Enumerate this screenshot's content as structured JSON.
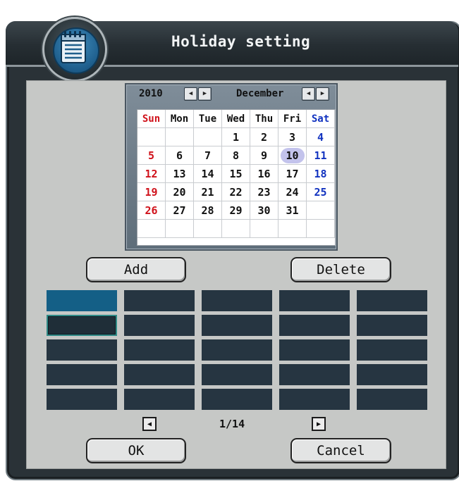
{
  "window": {
    "title": "Holiday setting",
    "icon": "notepad-icon"
  },
  "calendar": {
    "year": "2010",
    "month": "December",
    "weekdays": [
      "Sun",
      "Mon",
      "Tue",
      "Wed",
      "Thu",
      "Fri",
      "Sat"
    ],
    "weeks": [
      [
        "",
        "",
        "",
        "1",
        "2",
        "3",
        "4"
      ],
      [
        "5",
        "6",
        "7",
        "8",
        "9",
        "10",
        "11"
      ],
      [
        "12",
        "13",
        "14",
        "15",
        "16",
        "17",
        "18"
      ],
      [
        "19",
        "20",
        "21",
        "22",
        "23",
        "24",
        "25"
      ],
      [
        "26",
        "27",
        "28",
        "29",
        "30",
        "31",
        ""
      ],
      [
        "",
        "",
        "",
        "",
        "",
        "",
        ""
      ]
    ],
    "selected_day": "10",
    "colors": {
      "sunday": "#d0121b",
      "saturday": "#1233c0",
      "selected_highlight": "#c3c3ec"
    }
  },
  "buttons": {
    "add": "Add",
    "delete": "Delete",
    "ok": "OK",
    "cancel": "Cancel"
  },
  "holiday_list": {
    "rows": 5,
    "columns": 5,
    "entries": [
      "",
      "",
      "",
      "",
      "",
      "",
      "",
      "",
      "",
      "",
      "",
      "",
      "",
      "",
      "",
      "",
      "",
      "",
      "",
      "",
      "",
      "",
      "",
      "",
      ""
    ],
    "selected_index": 0,
    "focused_index": 5
  },
  "pager": {
    "text": "1/14",
    "prev_icon": "arrow-left-icon",
    "next_icon": "arrow-right-icon"
  },
  "colors": {
    "slot": "#263541",
    "slot_selected": "#145f86",
    "panel": "#c6c8c6",
    "frame": "#2a3237"
  }
}
